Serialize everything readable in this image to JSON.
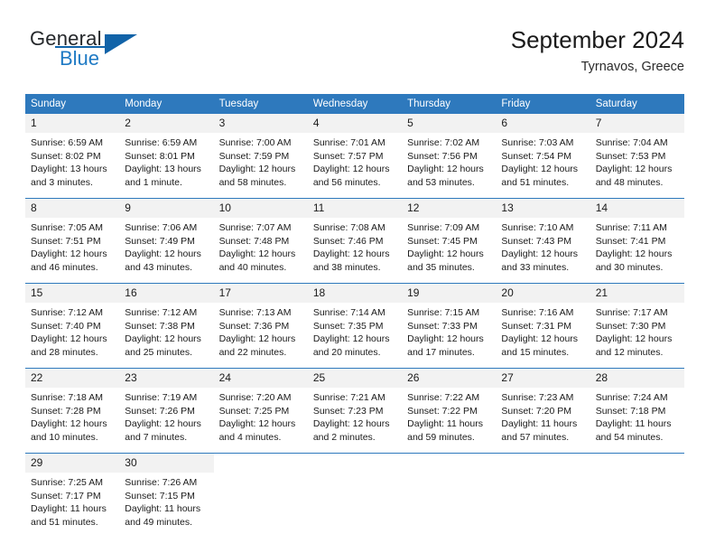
{
  "brand": {
    "name_part1": "General",
    "name_part2": "Blue",
    "accent_color": "#1163a8"
  },
  "header": {
    "title": "September 2024",
    "location": "Tyrnavos, Greece"
  },
  "theme": {
    "header_blue": "#2e79bd",
    "daynum_gray": "#f2f2f2"
  },
  "weekdays": [
    "Sunday",
    "Monday",
    "Tuesday",
    "Wednesday",
    "Thursday",
    "Friday",
    "Saturday"
  ],
  "weeks": [
    [
      {
        "day": "1",
        "lines": [
          "Sunrise: 6:59 AM",
          "Sunset: 8:02 PM",
          "Daylight: 13 hours",
          "and 3 minutes."
        ]
      },
      {
        "day": "2",
        "lines": [
          "Sunrise: 6:59 AM",
          "Sunset: 8:01 PM",
          "Daylight: 13 hours",
          "and 1 minute."
        ]
      },
      {
        "day": "3",
        "lines": [
          "Sunrise: 7:00 AM",
          "Sunset: 7:59 PM",
          "Daylight: 12 hours",
          "and 58 minutes."
        ]
      },
      {
        "day": "4",
        "lines": [
          "Sunrise: 7:01 AM",
          "Sunset: 7:57 PM",
          "Daylight: 12 hours",
          "and 56 minutes."
        ]
      },
      {
        "day": "5",
        "lines": [
          "Sunrise: 7:02 AM",
          "Sunset: 7:56 PM",
          "Daylight: 12 hours",
          "and 53 minutes."
        ]
      },
      {
        "day": "6",
        "lines": [
          "Sunrise: 7:03 AM",
          "Sunset: 7:54 PM",
          "Daylight: 12 hours",
          "and 51 minutes."
        ]
      },
      {
        "day": "7",
        "lines": [
          "Sunrise: 7:04 AM",
          "Sunset: 7:53 PM",
          "Daylight: 12 hours",
          "and 48 minutes."
        ]
      }
    ],
    [
      {
        "day": "8",
        "lines": [
          "Sunrise: 7:05 AM",
          "Sunset: 7:51 PM",
          "Daylight: 12 hours",
          "and 46 minutes."
        ]
      },
      {
        "day": "9",
        "lines": [
          "Sunrise: 7:06 AM",
          "Sunset: 7:49 PM",
          "Daylight: 12 hours",
          "and 43 minutes."
        ]
      },
      {
        "day": "10",
        "lines": [
          "Sunrise: 7:07 AM",
          "Sunset: 7:48 PM",
          "Daylight: 12 hours",
          "and 40 minutes."
        ]
      },
      {
        "day": "11",
        "lines": [
          "Sunrise: 7:08 AM",
          "Sunset: 7:46 PM",
          "Daylight: 12 hours",
          "and 38 minutes."
        ]
      },
      {
        "day": "12",
        "lines": [
          "Sunrise: 7:09 AM",
          "Sunset: 7:45 PM",
          "Daylight: 12 hours",
          "and 35 minutes."
        ]
      },
      {
        "day": "13",
        "lines": [
          "Sunrise: 7:10 AM",
          "Sunset: 7:43 PM",
          "Daylight: 12 hours",
          "and 33 minutes."
        ]
      },
      {
        "day": "14",
        "lines": [
          "Sunrise: 7:11 AM",
          "Sunset: 7:41 PM",
          "Daylight: 12 hours",
          "and 30 minutes."
        ]
      }
    ],
    [
      {
        "day": "15",
        "lines": [
          "Sunrise: 7:12 AM",
          "Sunset: 7:40 PM",
          "Daylight: 12 hours",
          "and 28 minutes."
        ]
      },
      {
        "day": "16",
        "lines": [
          "Sunrise: 7:12 AM",
          "Sunset: 7:38 PM",
          "Daylight: 12 hours",
          "and 25 minutes."
        ]
      },
      {
        "day": "17",
        "lines": [
          "Sunrise: 7:13 AM",
          "Sunset: 7:36 PM",
          "Daylight: 12 hours",
          "and 22 minutes."
        ]
      },
      {
        "day": "18",
        "lines": [
          "Sunrise: 7:14 AM",
          "Sunset: 7:35 PM",
          "Daylight: 12 hours",
          "and 20 minutes."
        ]
      },
      {
        "day": "19",
        "lines": [
          "Sunrise: 7:15 AM",
          "Sunset: 7:33 PM",
          "Daylight: 12 hours",
          "and 17 minutes."
        ]
      },
      {
        "day": "20",
        "lines": [
          "Sunrise: 7:16 AM",
          "Sunset: 7:31 PM",
          "Daylight: 12 hours",
          "and 15 minutes."
        ]
      },
      {
        "day": "21",
        "lines": [
          "Sunrise: 7:17 AM",
          "Sunset: 7:30 PM",
          "Daylight: 12 hours",
          "and 12 minutes."
        ]
      }
    ],
    [
      {
        "day": "22",
        "lines": [
          "Sunrise: 7:18 AM",
          "Sunset: 7:28 PM",
          "Daylight: 12 hours",
          "and 10 minutes."
        ]
      },
      {
        "day": "23",
        "lines": [
          "Sunrise: 7:19 AM",
          "Sunset: 7:26 PM",
          "Daylight: 12 hours",
          "and 7 minutes."
        ]
      },
      {
        "day": "24",
        "lines": [
          "Sunrise: 7:20 AM",
          "Sunset: 7:25 PM",
          "Daylight: 12 hours",
          "and 4 minutes."
        ]
      },
      {
        "day": "25",
        "lines": [
          "Sunrise: 7:21 AM",
          "Sunset: 7:23 PM",
          "Daylight: 12 hours",
          "and 2 minutes."
        ]
      },
      {
        "day": "26",
        "lines": [
          "Sunrise: 7:22 AM",
          "Sunset: 7:22 PM",
          "Daylight: 11 hours",
          "and 59 minutes."
        ]
      },
      {
        "day": "27",
        "lines": [
          "Sunrise: 7:23 AM",
          "Sunset: 7:20 PM",
          "Daylight: 11 hours",
          "and 57 minutes."
        ]
      },
      {
        "day": "28",
        "lines": [
          "Sunrise: 7:24 AM",
          "Sunset: 7:18 PM",
          "Daylight: 11 hours",
          "and 54 minutes."
        ]
      }
    ],
    [
      {
        "day": "29",
        "lines": [
          "Sunrise: 7:25 AM",
          "Sunset: 7:17 PM",
          "Daylight: 11 hours",
          "and 51 minutes."
        ]
      },
      {
        "day": "30",
        "lines": [
          "Sunrise: 7:26 AM",
          "Sunset: 7:15 PM",
          "Daylight: 11 hours",
          "and 49 minutes."
        ]
      },
      {
        "day": "",
        "lines": []
      },
      {
        "day": "",
        "lines": []
      },
      {
        "day": "",
        "lines": []
      },
      {
        "day": "",
        "lines": []
      },
      {
        "day": "",
        "lines": []
      }
    ]
  ]
}
